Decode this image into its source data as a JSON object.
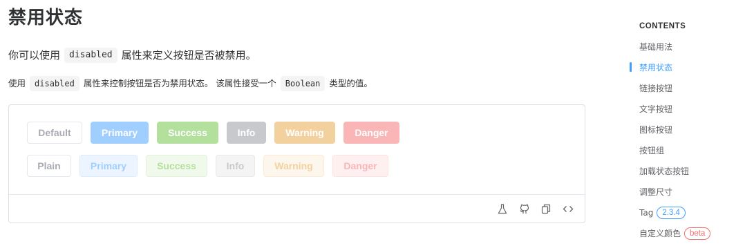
{
  "page": {
    "title": "禁用状态",
    "lead": {
      "before": "你可以使用",
      "code": "disabled",
      "after": "属性来定义按钮是否被禁用。"
    },
    "detail": {
      "part1": "使用",
      "code1": "disabled",
      "part2": "属性来控制按钮是否为禁用状态。 该属性接受一个",
      "code2": "Boolean",
      "part3": "类型的值。"
    }
  },
  "demo": {
    "row1": [
      "Default",
      "Primary",
      "Success",
      "Info",
      "Warning",
      "Danger"
    ],
    "row2": [
      "Plain",
      "Primary",
      "Success",
      "Info",
      "Warning",
      "Danger"
    ],
    "toolbar_icons": [
      "flask-icon",
      "github-icon",
      "copy-icon",
      "code-icon"
    ]
  },
  "toc": {
    "heading": "CONTENTS",
    "items": [
      "基础用法",
      "禁用状态",
      "链接按钮",
      "文字按钮",
      "图标按钮",
      "按钮组",
      "加载状态按钮",
      "调整尺寸",
      "Tag",
      "自定义颜色"
    ],
    "active": "禁用状态",
    "tag_badge": "2.3.4",
    "beta_badge": "beta"
  },
  "colors": {
    "accent": "#409eff",
    "primary_disabled": "#a0cfff",
    "success_disabled": "#b3e19d",
    "info_disabled": "#c8c9cc",
    "warning_disabled": "#f3d19e",
    "danger_disabled": "#fab6b6",
    "beta": "#f56c6c"
  }
}
